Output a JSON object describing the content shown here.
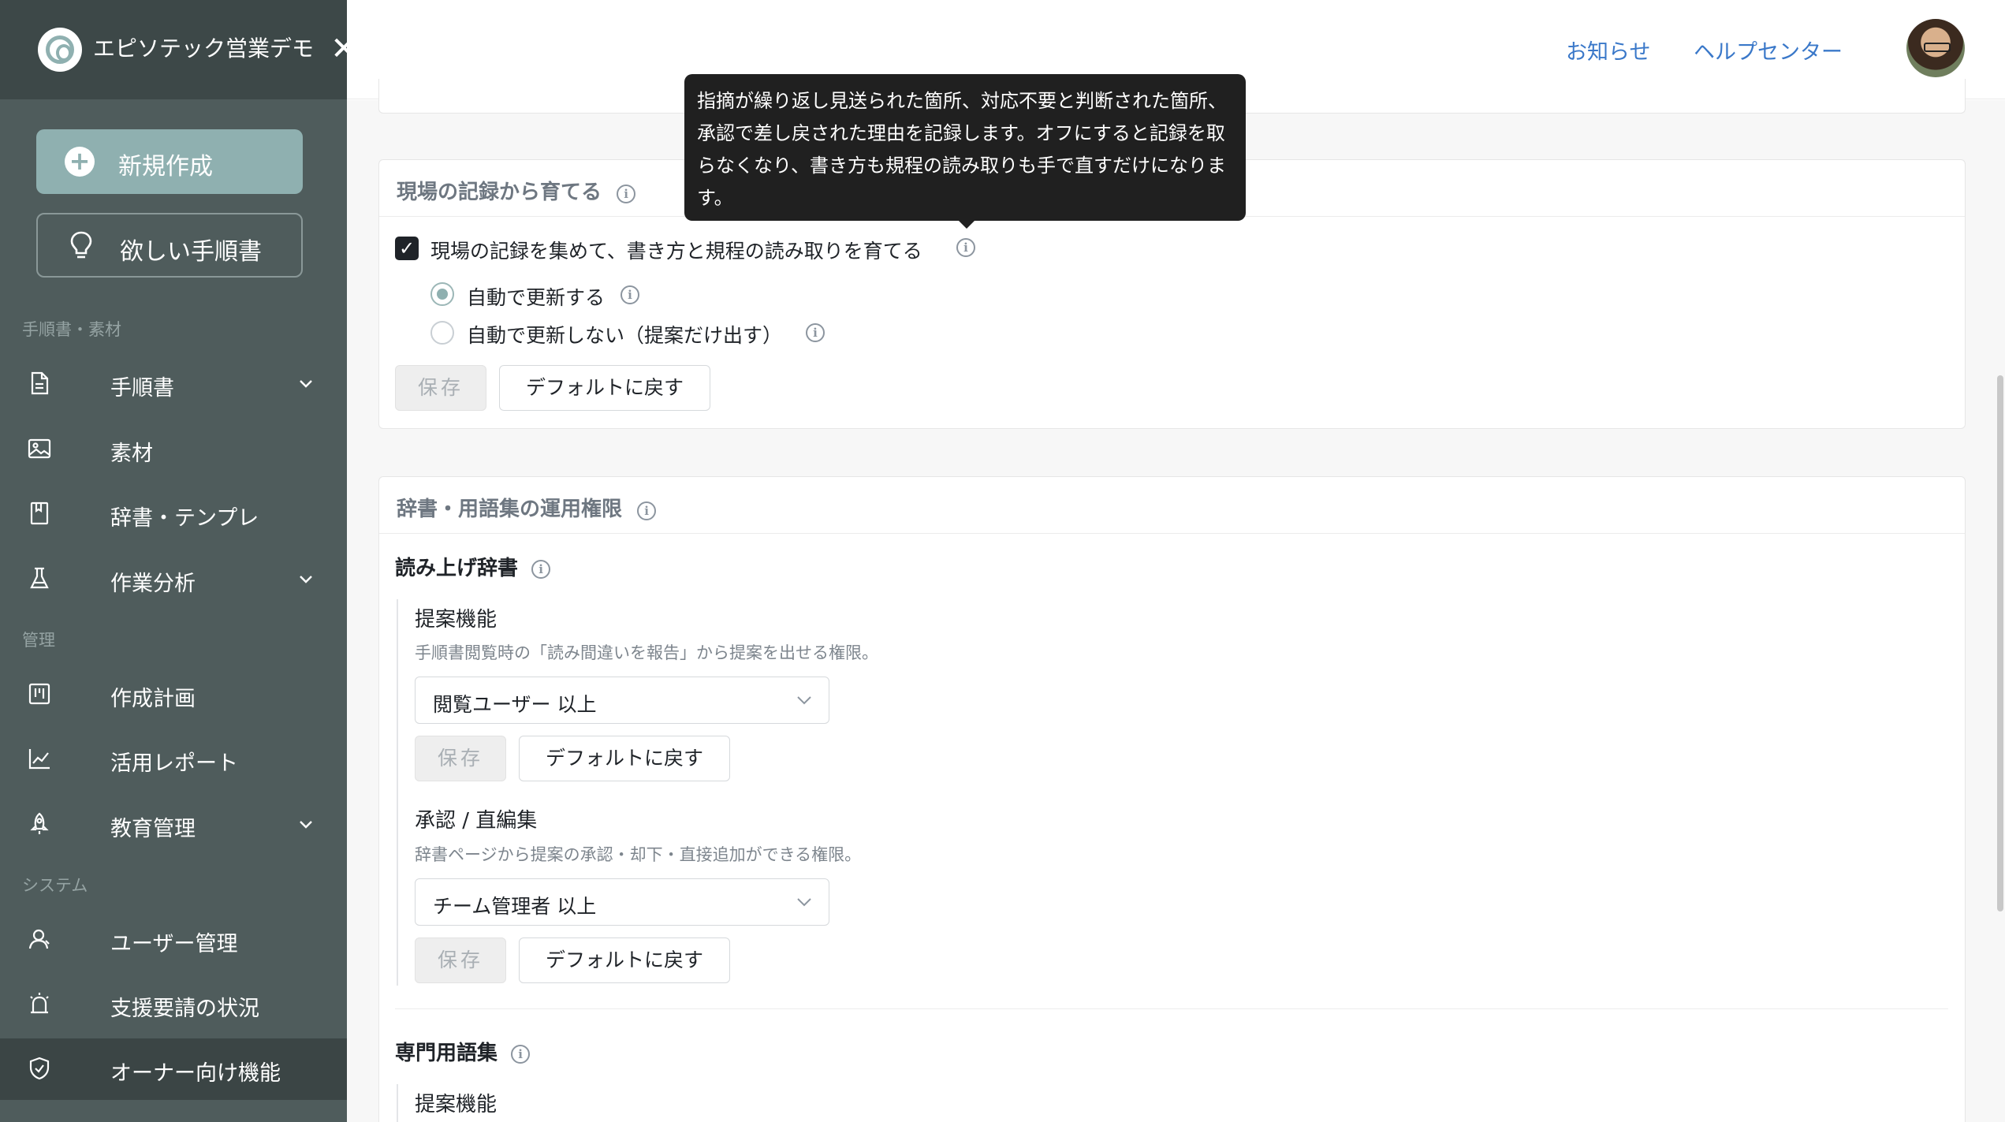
{
  "brand": {
    "name": "エピソテック営業デモ",
    "close_icon": "close-icon"
  },
  "sidebar": {
    "new_button": "新規作成",
    "want_button": "欲しい手順書",
    "sections": {
      "materials": "手順書・素材",
      "manage": "管理",
      "system": "システム"
    },
    "items": [
      {
        "label": "手順書",
        "icon": "document-icon",
        "expandable": true
      },
      {
        "label": "素材",
        "icon": "image-icon",
        "expandable": false
      },
      {
        "label": "辞書・テンプレ",
        "icon": "book-icon",
        "expandable": false
      },
      {
        "label": "作業分析",
        "icon": "flask-icon",
        "expandable": true
      },
      {
        "label": "作成計画",
        "icon": "board-icon",
        "expandable": false
      },
      {
        "label": "活用レポート",
        "icon": "chart-icon",
        "expandable": false
      },
      {
        "label": "教育管理",
        "icon": "rocket-icon",
        "expandable": true
      },
      {
        "label": "ユーザー管理",
        "icon": "user-icon",
        "expandable": false
      },
      {
        "label": "支援要請の状況",
        "icon": "alarm-icon",
        "expandable": false
      },
      {
        "label": "オーナー向け機能",
        "icon": "shield-check-icon",
        "expandable": false,
        "active": true
      }
    ],
    "colors": {
      "background": "#4f5c5c",
      "accent": "#8fb0b0",
      "active": "#3b4545"
    }
  },
  "header": {
    "links": {
      "news": "お知らせ",
      "help": "ヘルプセンター"
    },
    "link_color": "#3a78c9"
  },
  "tooltip": {
    "text": "指摘が繰り返し見送られた箇所、対応不要と判断された箇所、承認で差し戻された理由を記録します。オフにすると記録を取らなくなり、書き方も規程の読み取りも手で直すだけになります。"
  },
  "record_section": {
    "title": "現場の記録から育てる",
    "checkbox_label": "現場の記録を集めて、書き方と規程の読み取りを育てる",
    "checked": true,
    "radio_auto": "自動で更新する",
    "radio_manual": "自動で更新しない（提案だけ出す）",
    "selected": "auto",
    "save": "保存",
    "reset": "デフォルトに戻す"
  },
  "dictionary_section": {
    "title": "辞書・用語集の運用権限",
    "reading_dict": {
      "title": "読み上げ辞書",
      "proposal": {
        "title": "提案機能",
        "description": "手順書閲覧時の「読み間違いを報告」から提案を出せる権限。",
        "selected": "閲覧ユーザー 以上",
        "save": "保存",
        "reset": "デフォルトに戻す"
      },
      "approval": {
        "title": "承認 / 直編集",
        "description": "辞書ページから提案の承認・却下・直接追加ができる権限。",
        "selected": "チーム管理者 以上",
        "save": "保存",
        "reset": "デフォルトに戻す"
      }
    },
    "glossary": {
      "title": "専門用語集",
      "proposal_title": "提案機能"
    }
  }
}
